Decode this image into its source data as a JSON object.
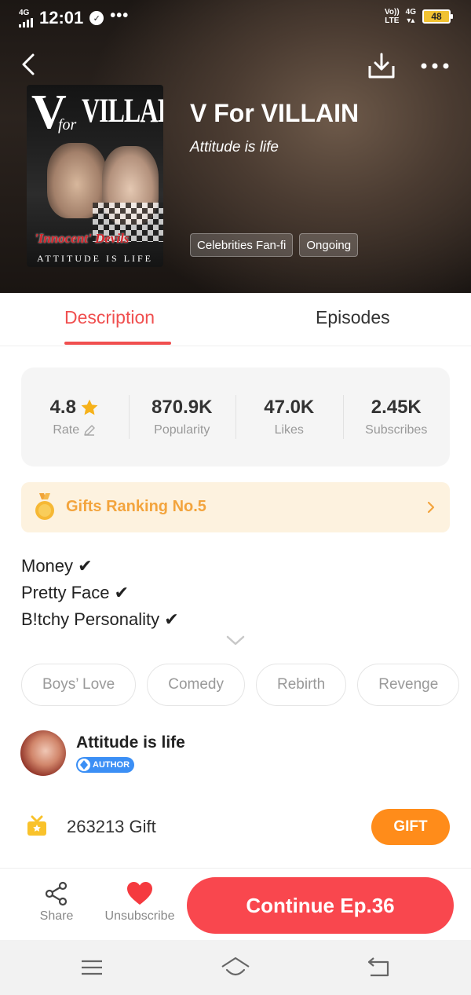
{
  "status_bar": {
    "network_label": "4G",
    "time": "12:01",
    "more_indicator": "•••",
    "volte_label": "Vo))",
    "lte_label": "LTE",
    "data_label": "4G",
    "battery": "48",
    "icons": [
      "signal-icon",
      "clock-app-icon",
      "volte-icon",
      "battery-icon"
    ]
  },
  "header": {
    "icons": [
      "back-arrow-icon",
      "download-icon",
      "more-options-icon"
    ]
  },
  "cover": {
    "title_big": "V",
    "title_for": "for",
    "title_villain": "VILLAIN",
    "subtitle": "'Innocent' Devils",
    "tagline": "ATTITUDE IS LIFE"
  },
  "book": {
    "title": "V For VILLAIN",
    "author_line": "Attitude is life",
    "chips": [
      "Celebrities Fan-fi",
      "Ongoing"
    ]
  },
  "tabs": {
    "description": "Description",
    "episodes": "Episodes",
    "active": "description"
  },
  "stats": [
    {
      "value": "4.8",
      "label": "Rate"
    },
    {
      "value": "870.9K",
      "label": "Popularity"
    },
    {
      "value": "47.0K",
      "label": "Likes"
    },
    {
      "value": "2.45K",
      "label": "Subscribes"
    }
  ],
  "ranking": {
    "text": "Gifts Ranking No.5"
  },
  "description": {
    "lines": [
      "Money ✔",
      "Pretty Face ✔",
      "B!tchy Personality ✔"
    ]
  },
  "tags": [
    "Boys’ Love",
    "Comedy",
    "Rebirth",
    "Revenge"
  ],
  "author": {
    "name": "Attitude is life",
    "badge": "AUTHOR"
  },
  "gift": {
    "count": "263213",
    "label": "Gift",
    "button": "GIFT"
  },
  "action_bar": {
    "share": "Share",
    "unsubscribe": "Unsubscribe",
    "continue": "Continue Ep.36"
  },
  "colors": {
    "accent_red": "#f04f4f",
    "continue_button": "#f9474e",
    "gift_button": "#ff8c1a",
    "ranking_bg": "#fdf2df",
    "ranking_text": "#f3a43d",
    "star": "#f6b21b",
    "author_badge": "#3b8ff5"
  }
}
